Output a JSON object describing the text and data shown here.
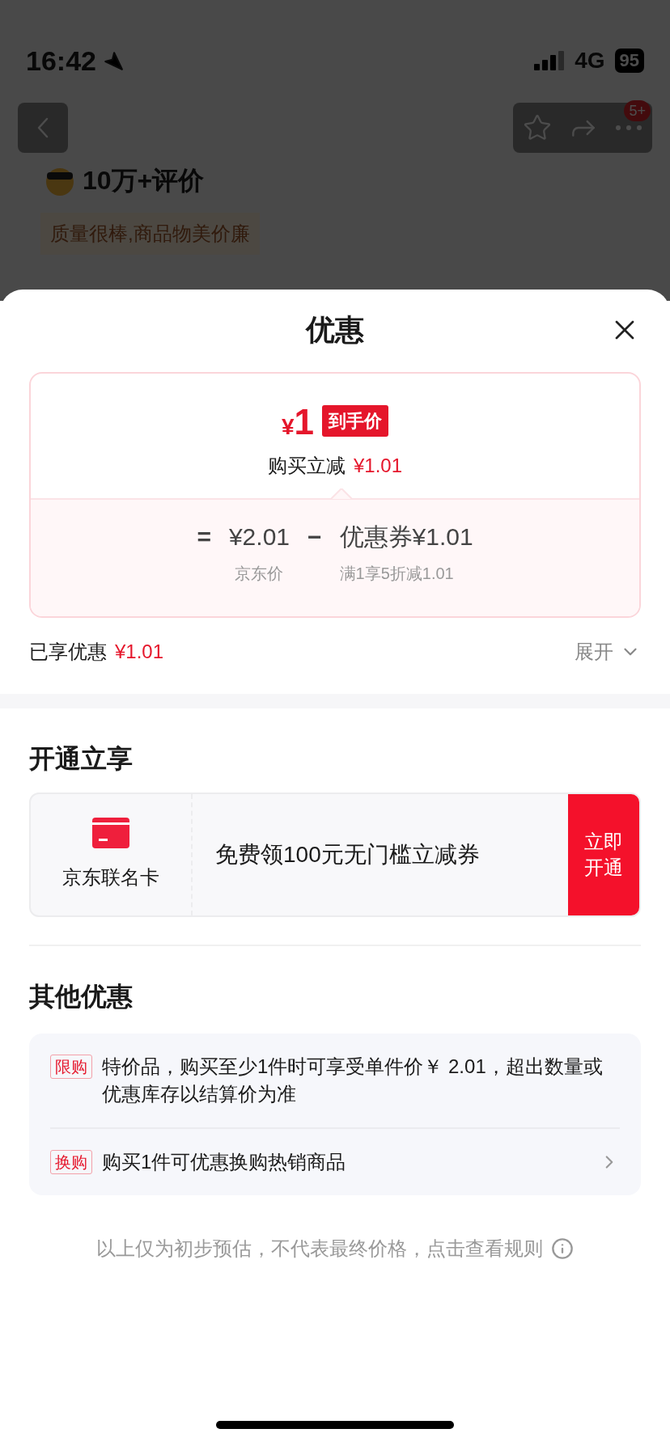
{
  "status_bar": {
    "time": "16:42",
    "network": "4G",
    "battery": "95"
  },
  "background_page": {
    "badge": "5+",
    "reviews_title": "10万+评价",
    "review_tag": "质量很棒,商品物美价廉"
  },
  "sheet": {
    "title": "优惠",
    "summary": {
      "currency": "¥",
      "price": "1",
      "price_tag": "到手价",
      "cut_label": "购买立减",
      "cut_amount": "¥1.01",
      "equals": "=",
      "base_price": "¥2.01",
      "base_label": "京东价",
      "minus": "−",
      "coupon_price": "优惠券¥1.01",
      "coupon_rule": "满1享5折减1.01"
    },
    "enjoyed": {
      "label": "已享优惠",
      "amount": "¥1.01",
      "expand": "展开",
      "expanded": false
    },
    "open_section": {
      "title": "开通立享",
      "card_name": "京东联名卡",
      "offer": "免费领100元无门槛立减券",
      "action": "立即开通"
    },
    "other_section": {
      "title": "其他优惠",
      "items": [
        {
          "tag": "限购",
          "text": "特价品，购买至少1件时可享受单件价￥ 2.01，超出数量或优惠库存以结算价为准",
          "has_arrow": false
        },
        {
          "tag": "换购",
          "text": "购买1件可优惠换购热销商品",
          "has_arrow": true
        }
      ]
    },
    "footnote": "以上仅为初步预估，不代表最终价格，点击查看规则"
  }
}
